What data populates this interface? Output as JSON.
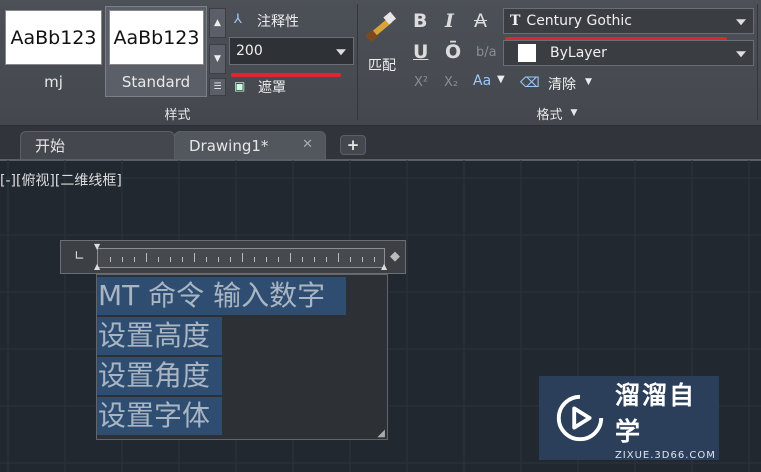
{
  "ribbon": {
    "style_panel": {
      "title": "样式",
      "thumbs": [
        {
          "preview": "AaBb123",
          "label": "mj"
        },
        {
          "preview": "AaBb123",
          "label": "Standard"
        }
      ],
      "annotative_label": "注释性",
      "text_height_value": "200",
      "mask_label": "遮罩"
    },
    "format_panel": {
      "title": "格式",
      "match_label": "匹配",
      "bold_label": "B",
      "italic_label": "I",
      "strike_label": "A",
      "underline_label": "U",
      "overline_label": "Ō",
      "font_value": "Century Gothic",
      "font_icon_glyph": "T",
      "color_value": "ByLayer",
      "clear_label": "清除",
      "case_label": "Aa",
      "superscript_label": "X²",
      "subscript_label": "X₂"
    }
  },
  "tabs": [
    {
      "label": "开始"
    },
    {
      "label": "Drawing1*"
    }
  ],
  "viewport_label": "[-][俯视][二维线框]",
  "mtext_lines": [
    "MT 命令 输入数字",
    "设置高度",
    "设置角度",
    "设置字体"
  ],
  "watermark": {
    "name": "溜溜自学",
    "url": "ZIXUE.3D66.COM"
  },
  "colors": {
    "accent_red": "#e0262d",
    "selection_blue": "#2e4d70",
    "canvas": "#212830"
  }
}
